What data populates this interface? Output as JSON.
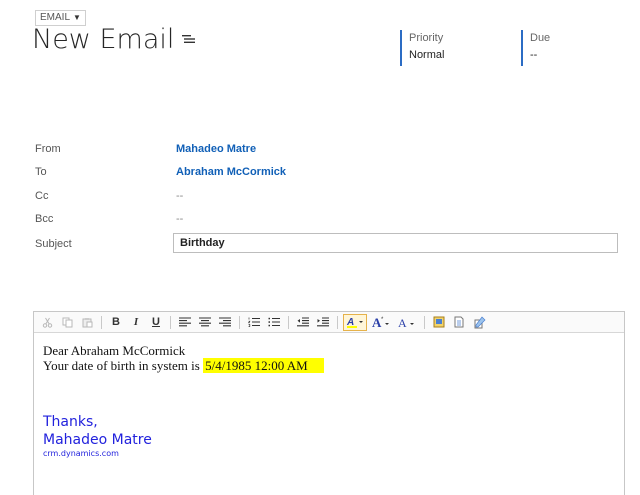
{
  "header": {
    "entity_type": "EMAIL",
    "title": "New Email",
    "priority_label": "Priority",
    "priority_value": "Normal",
    "due_label": "Due",
    "due_value": "--"
  },
  "form": {
    "from_label": "From",
    "from_value": "Mahadeo Matre",
    "to_label": "To",
    "to_value": "Abraham McCormick",
    "cc_label": "Cc",
    "cc_value": "--",
    "bcc_label": "Bcc",
    "bcc_value": "--",
    "subject_label": "Subject",
    "subject_value": "Birthday"
  },
  "editor": {
    "toolbar": {
      "cut": "cut-icon",
      "copy": "copy-icon",
      "paste": "paste-icon",
      "bold": "B",
      "italic": "I",
      "underline": "U",
      "align_left": "align-left-icon",
      "align_center": "align-center-icon",
      "align_right": "align-right-icon",
      "numbered_list": "numbered-list-icon",
      "bullet_list": "bullet-list-icon",
      "decrease_indent": "decrease-indent-icon",
      "increase_indent": "increase-indent-icon",
      "highlight": "highlight-icon",
      "font_size": "A",
      "font_color": "A",
      "insert": "insert-icon",
      "page": "page-icon",
      "template": "template-icon"
    },
    "greeting": "Dear Abraham McCormick",
    "dob_prefix": "Your date of birth in system is ",
    "dob_value": "5/4/1985 12:00 AM",
    "thanks": "Thanks,",
    "signature_name": "Mahadeo Matre",
    "signature_site": "crm.dynamics.com"
  },
  "colors": {
    "accent": "#2b6cc4",
    "link": "#1160b7",
    "highlight": "#ffff00",
    "signature": "#2222dd"
  }
}
